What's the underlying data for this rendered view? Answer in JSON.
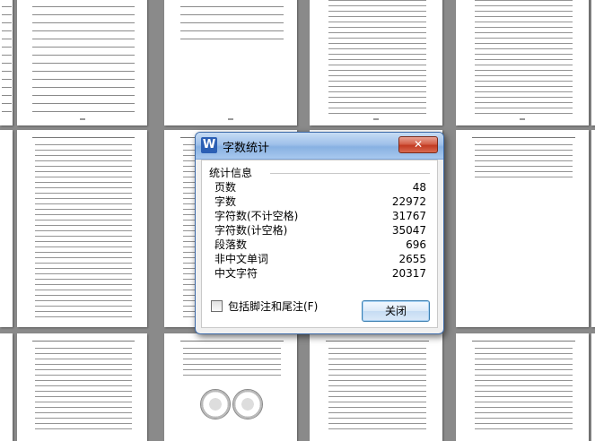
{
  "dialog": {
    "title": "字数统计",
    "app_icon_letter": "W",
    "close_icon": "✕",
    "group_title": "统计信息",
    "stats": [
      {
        "label": "页数",
        "value": "48"
      },
      {
        "label": "字数",
        "value": "22972"
      },
      {
        "label": "字符数(不计空格)",
        "value": "31767"
      },
      {
        "label": "字符数(计空格)",
        "value": "35047"
      },
      {
        "label": "段落数",
        "value": "696"
      },
      {
        "label": "非中文单词",
        "value": "2655"
      },
      {
        "label": "中文字符",
        "value": "20317"
      }
    ],
    "include_footnotes_label": "包括脚注和尾注(F)",
    "include_footnotes_checked": false,
    "close_button_label": "关闭"
  }
}
